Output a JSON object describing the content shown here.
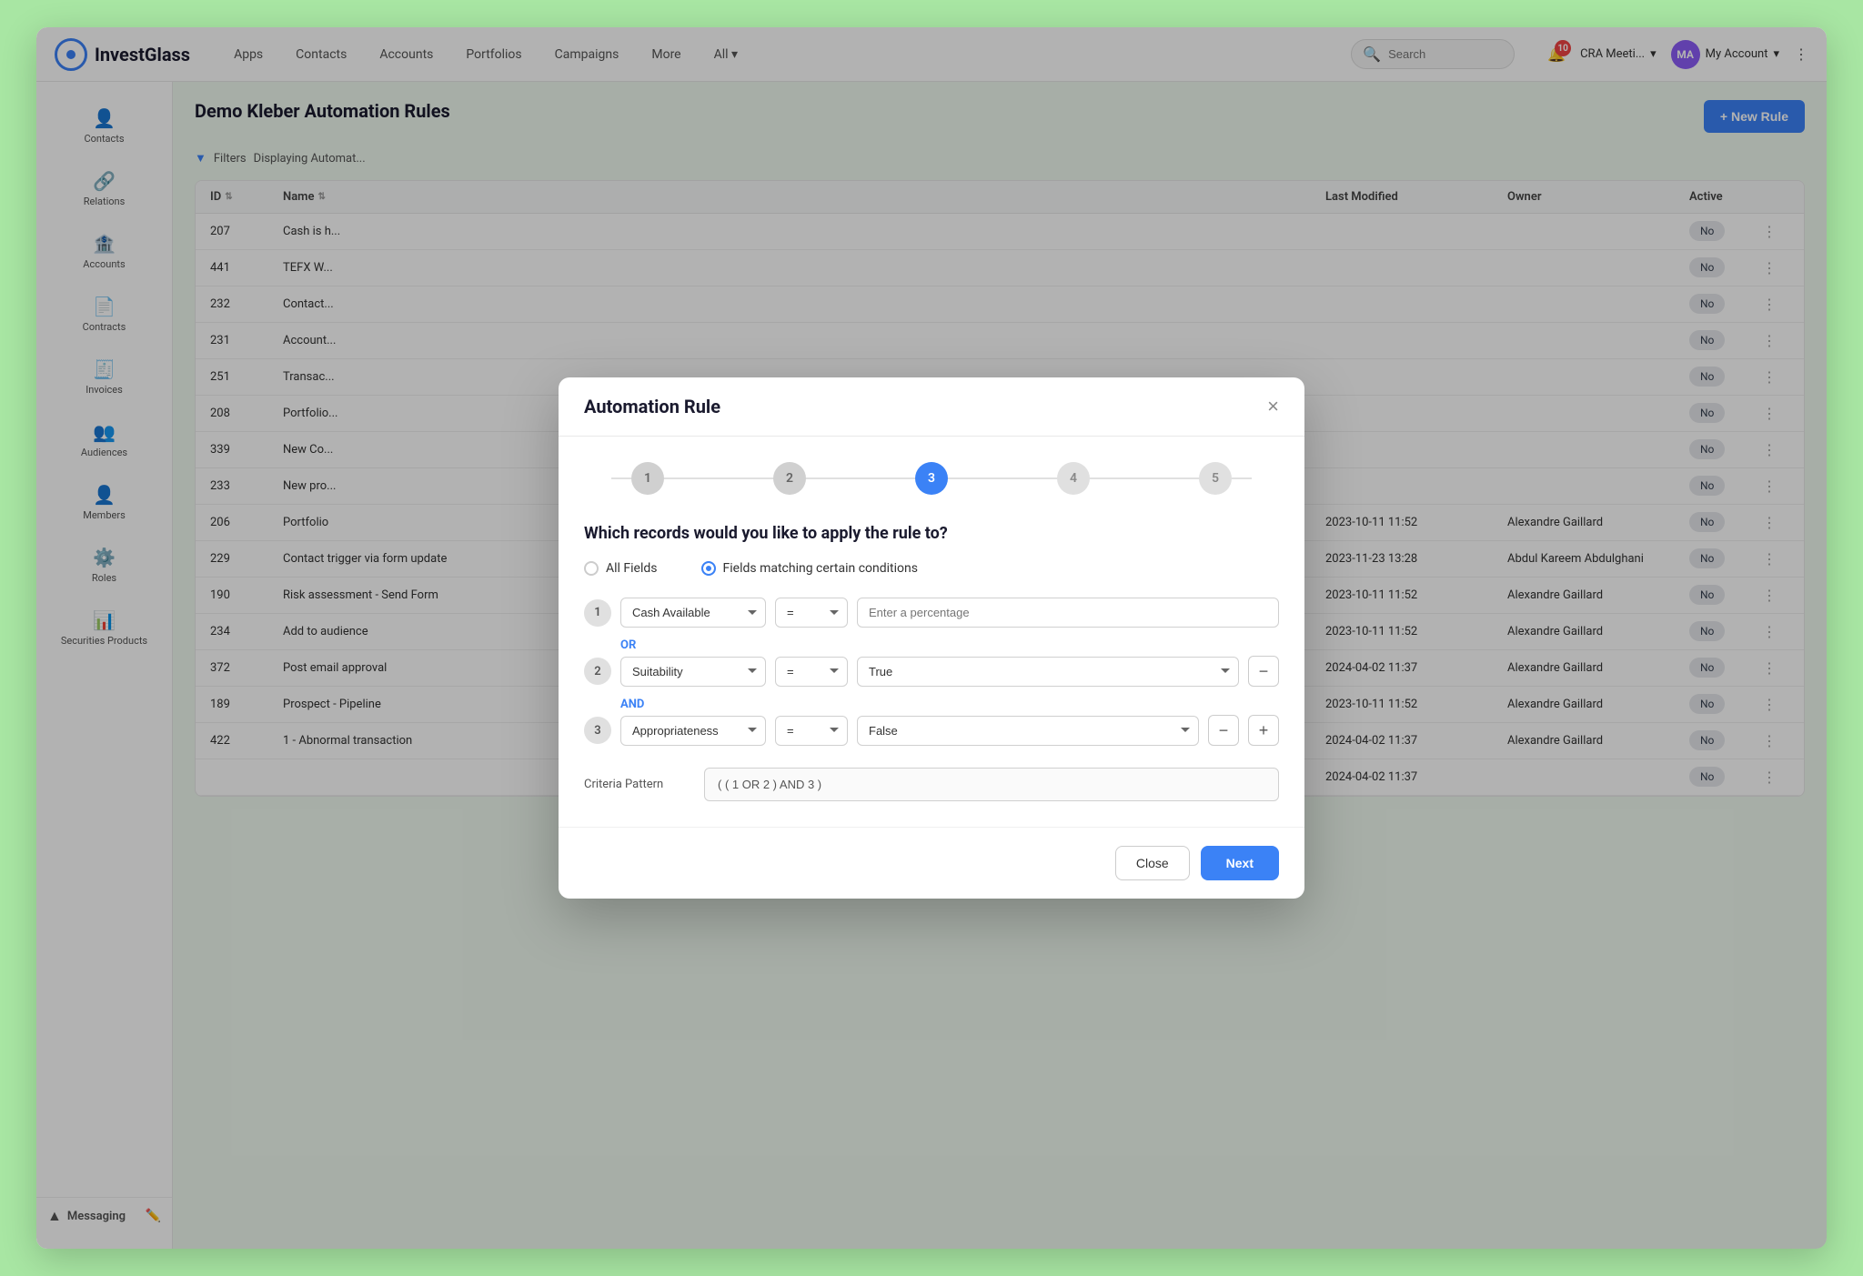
{
  "app": {
    "name": "InvestGlass",
    "nav_items": [
      "Apps",
      "Contacts",
      "Accounts",
      "Portfolios",
      "Campaigns",
      "More",
      "All ▾"
    ],
    "search_placeholder": "Search",
    "notification_count": "10",
    "account_label": "My Account",
    "meeting_label": "CRA Meeti..."
  },
  "sidebar": {
    "items": [
      {
        "label": "Contacts",
        "icon": "👤"
      },
      {
        "label": "Relations",
        "icon": "🔗"
      },
      {
        "label": "Accounts",
        "icon": "🏦"
      },
      {
        "label": "Contracts",
        "icon": "📄"
      },
      {
        "label": "Invoices",
        "icon": "🧾"
      },
      {
        "label": "Audiences",
        "icon": "👥"
      },
      {
        "label": "Members",
        "icon": "👤"
      },
      {
        "label": "Roles",
        "icon": "⚙️"
      },
      {
        "label": "Securities Products",
        "icon": "📊"
      },
      {
        "label": "Messaging",
        "icon": "💬",
        "section": true
      }
    ]
  },
  "page": {
    "title": "Demo Kleber Automation Rules",
    "subtitle": "Displaying Automat...",
    "filters_label": "Filters",
    "new_rule_label": "+ New Rule"
  },
  "table": {
    "columns": [
      "ID",
      "Name",
      "Last Modified",
      "Owner",
      "Active"
    ],
    "rows": [
      {
        "id": "207",
        "name": "Cash is h...",
        "modified": "",
        "owner": "",
        "active": "No"
      },
      {
        "id": "441",
        "name": "TEFX W...",
        "modified": "",
        "owner": "",
        "active": "No"
      },
      {
        "id": "232",
        "name": "Contact...",
        "modified": "",
        "owner": "",
        "active": "No"
      },
      {
        "id": "231",
        "name": "Account...",
        "modified": "",
        "owner": "",
        "active": "No"
      },
      {
        "id": "251",
        "name": "Transac...",
        "modified": "",
        "owner": "",
        "active": "No"
      },
      {
        "id": "208",
        "name": "Portfolio...",
        "modified": "",
        "owner": "",
        "active": "No"
      },
      {
        "id": "339",
        "name": "New Co...",
        "modified": "",
        "owner": "",
        "active": "No"
      },
      {
        "id": "233",
        "name": "New pro...",
        "modified": "",
        "owner": "",
        "active": "No"
      },
      {
        "id": "206",
        "name": "Portfolio",
        "modified": "2023-10-11 11:52",
        "owner": "Alexandre Gaillard",
        "active": "No"
      },
      {
        "id": "229",
        "name": "Contact trigger via form update",
        "modified": "2023-11-23 13:28",
        "owner": "Abdul Kareem Abdulghani",
        "active": "No"
      },
      {
        "id": "190",
        "name": "Risk assessment - Send Form",
        "modified": "2023-10-11 11:52",
        "owner": "Alexandre Gaillard",
        "active": "No"
      },
      {
        "id": "234",
        "name": "Add to audience",
        "modified": "2023-10-11 11:52",
        "owner": "Alexandre Gaillard",
        "active": "No"
      },
      {
        "id": "372",
        "name": "Post email approval",
        "modified": "2024-04-02 11:37",
        "owner": "Alexandre Gaillard",
        "active": "No"
      },
      {
        "id": "189",
        "name": "Prospect - Pipeline",
        "modified": "2023-10-11 11:52",
        "owner": "Alexandre Gaillard",
        "active": "No"
      },
      {
        "id": "422",
        "name": "1 - Abnormal transaction",
        "modified": "2024-04-02 11:37",
        "owner": "Alexandre Gaillard",
        "active": "No"
      },
      {
        "id": "",
        "name": "",
        "modified": "2024-04-02 11:37",
        "owner": "",
        "active": "No"
      }
    ]
  },
  "modal": {
    "title": "Automation Rule",
    "close_label": "×",
    "steps": [
      "1",
      "2",
      "3",
      "4",
      "5"
    ],
    "active_step": 3,
    "question": "Which records would you like to apply the rule to?",
    "radio_options": [
      {
        "label": "All Fields",
        "selected": false
      },
      {
        "label": "Fields matching certain conditions",
        "selected": true
      }
    ],
    "conditions": [
      {
        "number": "1",
        "field": "Cash Available",
        "operator": "=",
        "value_type": "input",
        "value": "",
        "value_placeholder": "Enter a percentage",
        "connector": "OR"
      },
      {
        "number": "2",
        "field": "Suitability",
        "operator": "=",
        "value_type": "select",
        "value": "True",
        "connector": "AND"
      },
      {
        "number": "3",
        "field": "Appropriateness",
        "operator": "=",
        "value_type": "select",
        "value": "False",
        "connector": null
      }
    ],
    "criteria_pattern_label": "Criteria Pattern",
    "criteria_pattern_value": "( ( 1 OR 2 ) AND 3 )",
    "close_btn": "Close",
    "next_btn": "Next"
  }
}
